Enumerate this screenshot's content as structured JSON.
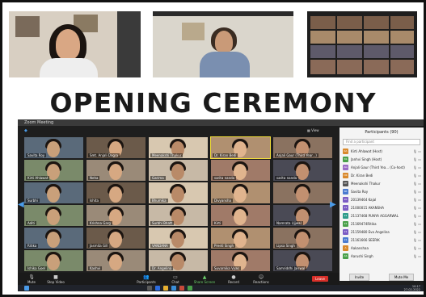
{
  "headline": "OPENING CEREMONY",
  "zoom_window": {
    "title": "Zoom Meeting",
    "view_label": "View"
  },
  "tiles": [
    "Savita Roy",
    "Smt. Anjali Dogra",
    "Meenakshi Thakur",
    "Dr. Kiran Bedi",
    "Anjali Gaur (Third Year...)",
    "Kirti Ahlawat",
    "Neha",
    "Garima",
    "sarita nanda",
    "",
    "Surbhi",
    "Ishita",
    "Bhumika",
    "Divyansha",
    "",
    "Aditi",
    "Krishna Garg",
    "Surbhi Bhatt",
    "Kirti",
    "Namrata Ujjwal",
    "Ritika",
    "Jasmita Gill",
    "VANDANA",
    "Preeti Singh",
    "Lipsa Singh",
    "Ishika Goel",
    "Kashvi",
    "Dr. Angelina",
    "Suvarnika Vyas",
    "Samriddhi Jaiswal"
  ],
  "center_label": "sarita nanda",
  "participants": {
    "title": "Participants (90)",
    "search_placeholder": "Find a participant",
    "items": [
      {
        "initials": "KA",
        "name": "Kirti Ahlawat (Host)",
        "color": "#d9892c"
      },
      {
        "initials": "SS",
        "name": "Janhvi Singh (Host)",
        "color": "#4aa04a"
      },
      {
        "initials": "AG",
        "name": "Anjali Gaur (Third Yea... (Co-host)",
        "color": "#9a6bc4"
      },
      {
        "initials": "DK",
        "name": "Dr. Kiran Bedi",
        "color": "#d9892c"
      },
      {
        "initials": "MT",
        "name": "Meenakshi Thakur",
        "color": "#555555"
      },
      {
        "initials": "SR",
        "name": "Savita Roy",
        "color": "#4a7bd0"
      },
      {
        "initials": "20",
        "name": "20139464 Kajal",
        "color": "#7b5cc4"
      },
      {
        "initials": "21",
        "name": "21000015 AKANSHA",
        "color": "#7b5cc4"
      },
      {
        "initials": "21",
        "name": "21137468 PUNYA AGGARWAL",
        "color": "#2d9c8a"
      },
      {
        "initials": "21",
        "name": "21169474Ritika",
        "color": "#4aa04a"
      },
      {
        "initials": "21",
        "name": "21159480 Eva Angelina",
        "color": "#7b5cc4"
      },
      {
        "initials": "21",
        "name": "21161666 SEERIK",
        "color": "#4a7bd0"
      },
      {
        "initials": "A",
        "name": "Aakanshaa",
        "color": "#d9892c"
      },
      {
        "initials": "AS",
        "name": "Aarushi Singh",
        "color": "#4aa04a"
      }
    ],
    "invite": "Invite",
    "mute_me": "Mute Me"
  },
  "toolbar": {
    "mute": "Mute",
    "stop_video": "Stop Video",
    "participants": "Participants",
    "chat": "Chat",
    "share_screen": "Share Screen",
    "record": "Record",
    "reactions": "Reactions",
    "leave": "Leave"
  },
  "taskbar_time": "10:17",
  "taskbar_date": "27-02-2022",
  "colors": {
    "leave": "#d9302a",
    "accent": "#4a9be8"
  }
}
